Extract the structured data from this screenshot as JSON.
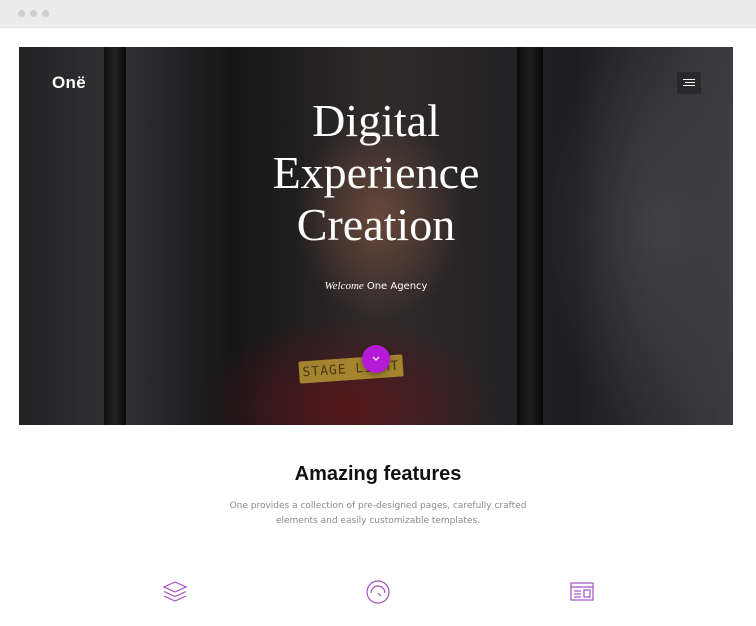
{
  "hero": {
    "logo": "Onë",
    "title_lines": [
      "Digital",
      "Experience",
      "Creation"
    ],
    "welcome_italic": "Welcome",
    "welcome_text": "One Agency",
    "sticker_text": "STAGE LIGHT"
  },
  "features": {
    "title": "Amazing features",
    "description": "One provides a collection of pre-designed pages, carefully crafted elements and easily customizable templates.",
    "icons": [
      "layers-icon",
      "speedometer-icon",
      "browser-window-icon"
    ]
  },
  "colors": {
    "accent": "#b51bd6",
    "icon_color": "#a64fc0"
  }
}
